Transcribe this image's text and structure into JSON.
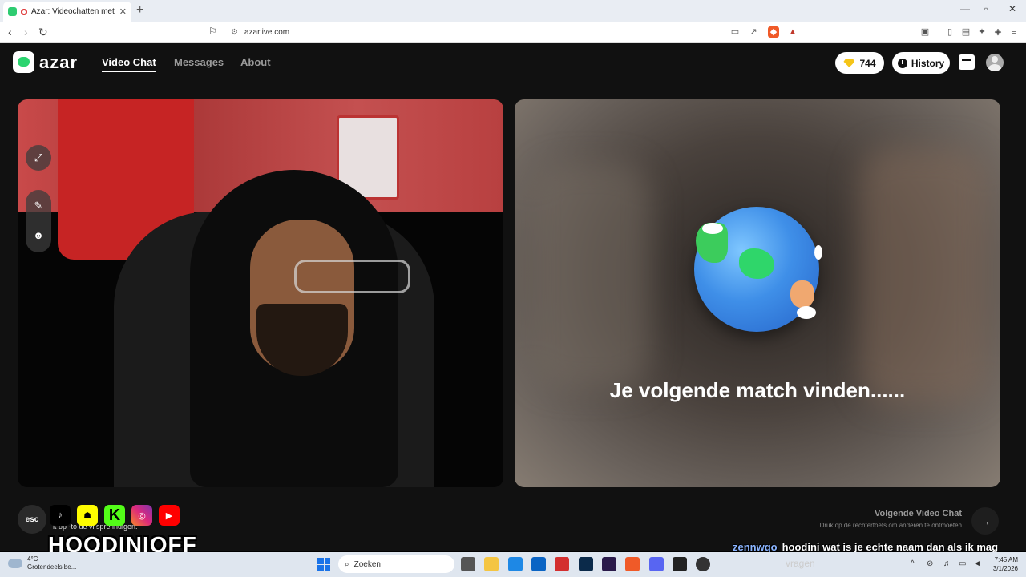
{
  "browser": {
    "tab_title": "Azar: Videochatten met nieuw",
    "new_tab": "+",
    "url": "azarlive.com",
    "window_controls": {
      "minimize": "—",
      "maximize": "▫",
      "close": "✕"
    }
  },
  "site": {
    "logo_text": "azar",
    "nav": [
      {
        "label": "Video Chat",
        "active": true
      },
      {
        "label": "Messages",
        "active": false
      },
      {
        "label": "About",
        "active": false
      }
    ],
    "gems_count": "744",
    "history_label": "History"
  },
  "match": {
    "status_text": "Je volgende match vinden......"
  },
  "bottom": {
    "esc_label": "esc",
    "left_hint_title": "ind",
    "left_hint_text": "k op       -to      de vi      spre       indigen.",
    "next_title": "Volgende Video Chat",
    "next_subtitle": "Druk op de rechtertoets om anderen te ontmoeten",
    "next_arrow": "→"
  },
  "overlay": {
    "streamer_name": "HOODINIOFF",
    "socials": [
      "tiktok-icon",
      "snapchat-icon",
      "kick-icon",
      "instagram-icon",
      "youtube-icon"
    ],
    "kick_letter": "K",
    "chat": {
      "user": "zennwqo",
      "message": "hoodini wat is je echte naam dan als ik mag"
    }
  },
  "taskbar": {
    "weather_temp": "4°C",
    "weather_desc": "Grotendeels be...",
    "search_placeholder": "Zoeken",
    "overlay_text": "vragen",
    "time": "7:45 AM",
    "date": "3/1/2026"
  },
  "colors": {
    "brand_green": "#2bd46f",
    "page_bg": "#111111",
    "chat_user": "#8ab4ff",
    "gem": "#f5c518"
  }
}
